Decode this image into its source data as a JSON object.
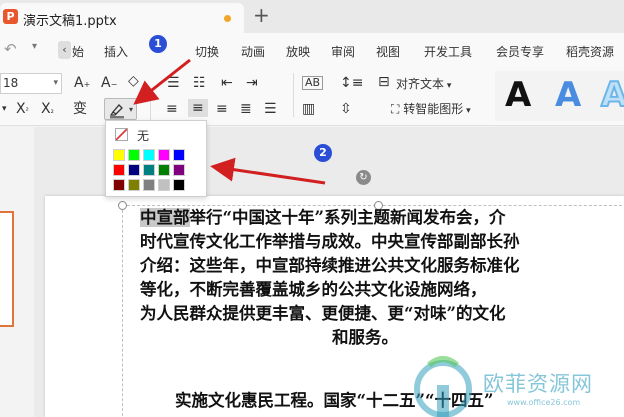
{
  "window": {
    "logo_letter": "P",
    "doc_title": "演示文稿1.pptx",
    "new_tab": "+"
  },
  "ribbon": {
    "menu_back": "‹",
    "tabs": [
      "始",
      "插入",
      "切换",
      "动画",
      "放映",
      "审阅",
      "视图",
      "开发工具",
      "会员专享",
      "稻壳资源"
    ],
    "font_size": "18",
    "align_text_label": "对齐文本",
    "smartart_label": "转智能图形",
    "art_style_letter": "A"
  },
  "highlight_popup": {
    "no_color_label": "无",
    "colors": [
      "#ffff00",
      "#00ff00",
      "#00ffff",
      "#ff00ff",
      "#0000ff",
      "#ff0000",
      "#000080",
      "#008080",
      "#008000",
      "#800080",
      "#800000",
      "#808000",
      "#808080",
      "#c0c0c0",
      "#000000"
    ]
  },
  "annotations": {
    "step1": "1",
    "step2": "2"
  },
  "slide": {
    "line1_highlighted": "中宣部",
    "line1_rest": "举行“中国这十年”系列主题新闻发布会，介",
    "line2": "时代宣传文化工作举措与成效。中央宣传部副部长孙",
    "line3": "介绍：这些年，中宣部持续推进公共文化服务标准化",
    "line4": "等化，不断完善覆盖城乡的公共文化设施网络，",
    "line5": "为人民群众提供更丰富、更便捷、更“对味”的文化",
    "line6": "和服务。",
    "line7": "实施文化惠民工程。国家“十二五”“十四五”"
  },
  "watermark": {
    "text": "欧菲资源网",
    "url": "www.office26.com"
  }
}
